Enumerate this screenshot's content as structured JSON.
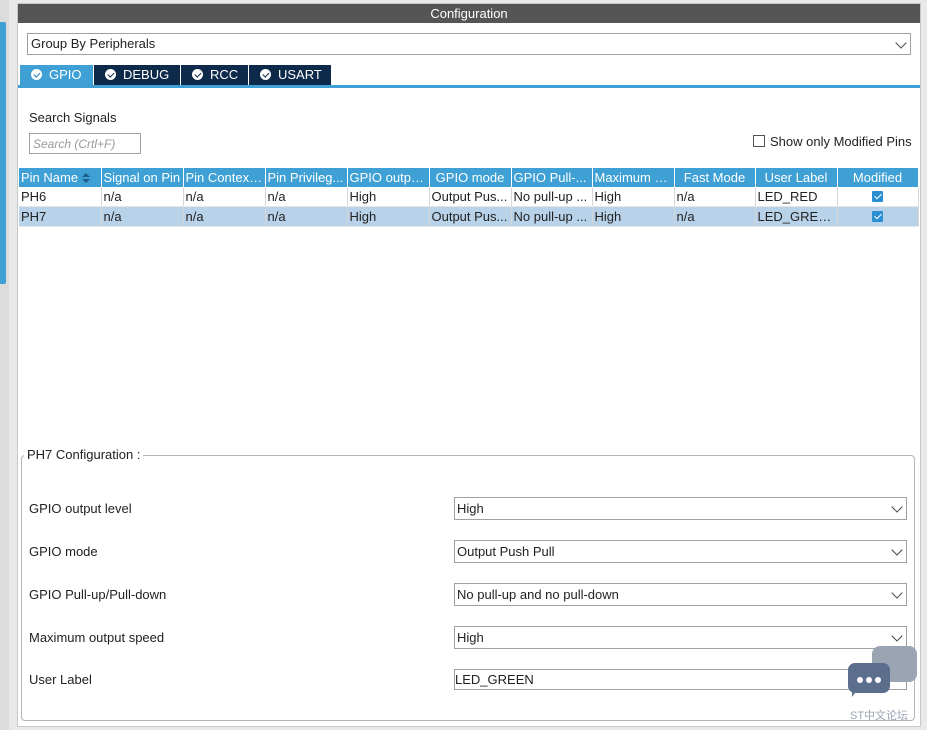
{
  "window": {
    "title": "Configuration"
  },
  "group_by": {
    "value": "Group By Peripherals"
  },
  "tabs": [
    {
      "label": "GPIO",
      "active": true
    },
    {
      "label": "DEBUG",
      "active": false
    },
    {
      "label": "RCC",
      "active": false
    },
    {
      "label": "USART",
      "active": false
    }
  ],
  "search": {
    "label": "Search Signals",
    "placeholder": "Search (Crtl+F)"
  },
  "show_modified": {
    "label": "Show only Modified Pins",
    "checked": false
  },
  "table": {
    "columns": [
      "Pin Name",
      "Signal on Pin",
      "Pin Context...",
      "Pin Privileg...",
      "GPIO outpu...",
      "GPIO mode",
      "GPIO Pull-...",
      "Maximum o...",
      "Fast Mode",
      "User Label",
      "Modified"
    ],
    "rows": [
      {
        "pin": "PH6",
        "signal": "n/a",
        "context": "n/a",
        "privilege": "n/a",
        "output": "High",
        "mode": "Output Pus...",
        "pull": "No pull-up ...",
        "speed": "High",
        "fast": "n/a",
        "label": "LED_RED",
        "modified": true
      },
      {
        "pin": "PH7",
        "signal": "n/a",
        "context": "n/a",
        "privilege": "n/a",
        "output": "High",
        "mode": "Output Pus...",
        "pull": "No pull-up ...",
        "speed": "High",
        "fast": "n/a",
        "label": "LED_GREEN",
        "modified": true
      }
    ]
  },
  "config": {
    "title": "PH7 Configuration :",
    "fields": [
      {
        "label": "GPIO output level",
        "value": "High"
      },
      {
        "label": "GPIO mode",
        "value": "Output Push Pull"
      },
      {
        "label": "GPIO Pull-up/Pull-down",
        "value": "No pull-up and no pull-down"
      },
      {
        "label": "Maximum output speed",
        "value": "High"
      },
      {
        "label": "User Label",
        "value": "LED_GREEN"
      }
    ]
  },
  "watermark": {
    "text": "ST中文论坛"
  },
  "colors": {
    "accent": "#3ea0d4",
    "tab_inactive": "#0d2a4a",
    "title_bar": "#555555",
    "selected_row": "#b8d2ea"
  }
}
